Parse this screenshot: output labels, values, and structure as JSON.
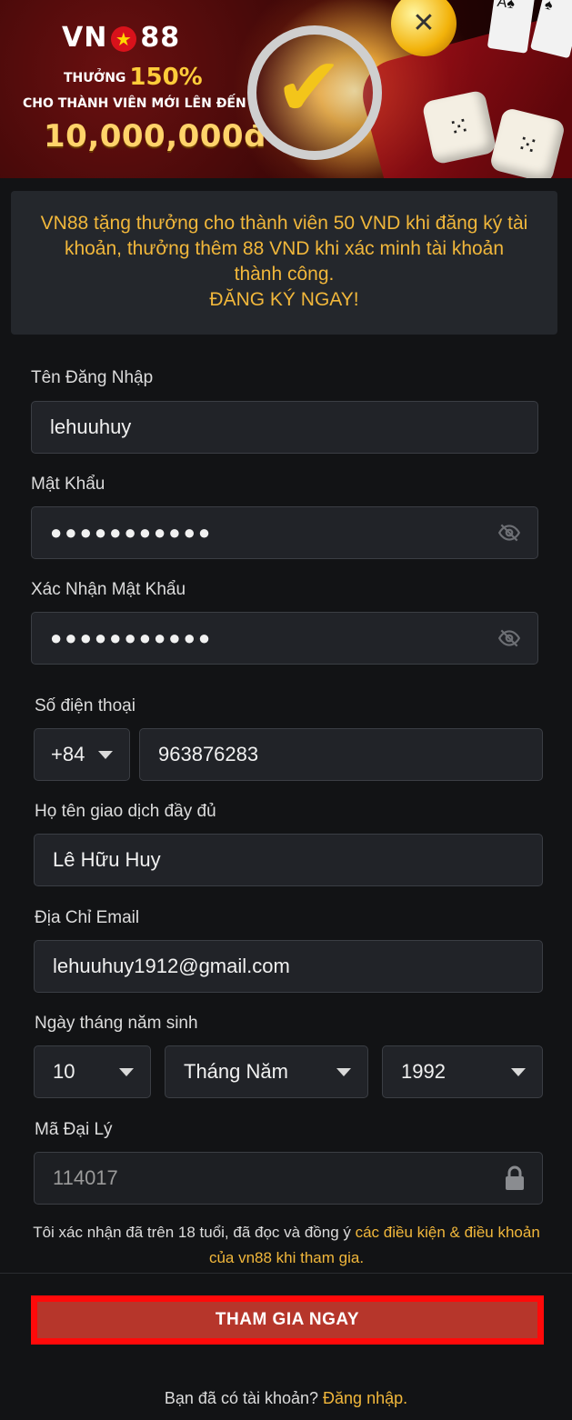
{
  "banner": {
    "brand_left": "VN",
    "brand_star": "★",
    "brand_right": "88",
    "promo_line1": "THƯỞNG",
    "promo_percent": "150%",
    "promo_line2": "CHO THÀNH VIÊN MỚI LÊN ĐẾN",
    "promo_amount": "10,000,000đ"
  },
  "info": {
    "text": "VN88 tặng thưởng cho thành viên 50 VND khi đăng ký tài khoản, thưởng thêm 88 VND khi xác minh tài khoản thành công.",
    "cta": "ĐĂNG KÝ NGAY!"
  },
  "form": {
    "username_label": "Tên Đăng Nhập",
    "username_value": "lehuuhuy",
    "password_label": "Mật Khẩu",
    "password_value": "●●●●●●●●●●●",
    "confirm_label": "Xác Nhận Mật Khẩu",
    "confirm_value": "●●●●●●●●●●●",
    "phone_label": "Số điện thoại",
    "phone_code": "+84",
    "phone_value": "963876283",
    "fullname_label": "Họ tên giao dịch đầy đủ",
    "fullname_value": "Lê Hữu Huy",
    "email_label": "Địa Chỉ Email",
    "email_value": "lehuuhuy1912@gmail.com",
    "dob_label": "Ngày tháng năm sinh",
    "dob_day": "10",
    "dob_month": "Tháng Năm",
    "dob_year": "1992",
    "agent_label": "Mã Đại Lý",
    "agent_value": "114017"
  },
  "terms": {
    "text": "Tôi xác nhận đã trên 18 tuổi, đã đọc và đồng ý ",
    "link": "các điều kiện & điều khoản của vn88 khi tham gia."
  },
  "submit_label": "THAM GIA NGAY",
  "login": {
    "text": "Bạn đã có tài khoản? ",
    "link": "Đăng nhập."
  },
  "colors": {
    "accent": "#f1b73b",
    "submit": "#b6362b",
    "highlight_border": "#ff0a0a",
    "background": "#121315"
  }
}
